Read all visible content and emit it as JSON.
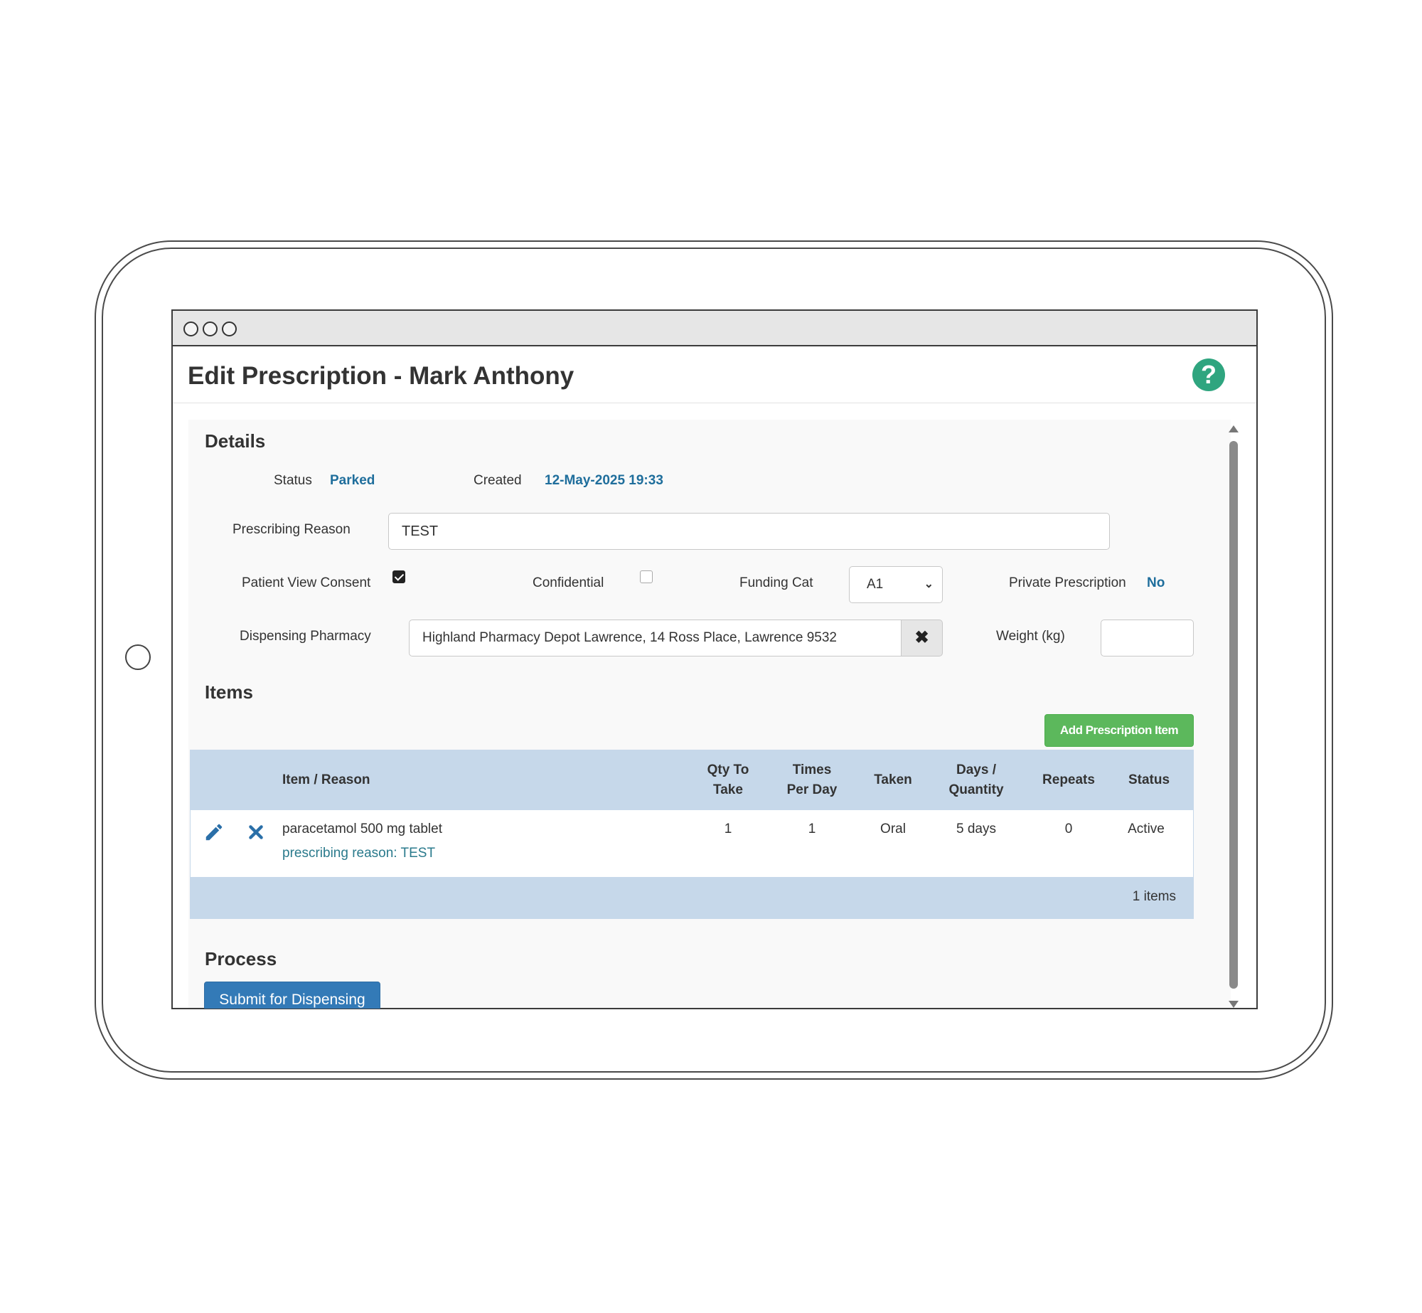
{
  "window": {
    "controls": [
      "close",
      "minimize",
      "maximize"
    ]
  },
  "header": {
    "title": "Edit Prescription - Mark Anthony",
    "help_icon": "question-circle-icon"
  },
  "details": {
    "section_title": "Details",
    "status_label": "Status",
    "status_value": "Parked",
    "created_label": "Created",
    "created_value": "12-May-2025 19:33",
    "prescribing_reason_label": "Prescribing Reason",
    "prescribing_reason_value": "TEST",
    "patient_view_consent_label": "Patient View Consent",
    "patient_view_consent_checked": true,
    "confidential_label": "Confidential",
    "confidential_checked": false,
    "funding_cat_label": "Funding Cat",
    "funding_cat_value": "A1",
    "private_prescription_label": "Private Prescription",
    "private_prescription_value": "No",
    "dispensing_pharmacy_label": "Dispensing Pharmacy",
    "dispensing_pharmacy_value": "Highland Pharmacy Depot Lawrence, 14 Ross Place, Lawrence 9532",
    "clear_glyph": "✖",
    "weight_label": "Weight (kg)",
    "weight_value": ""
  },
  "items": {
    "section_title": "Items",
    "add_button_label": "Add Prescription Item",
    "columns": {
      "item_reason": "Item / Reason",
      "qty_to_take_1": "Qty To",
      "qty_to_take_2": "Take",
      "times_per_day_1": "Times",
      "times_per_day_2": "Per Day",
      "taken": "Taken",
      "days_quantity_1": "Days /",
      "days_quantity_2": "Quantity",
      "repeats": "Repeats",
      "status": "Status"
    },
    "rows": [
      {
        "item": "paracetamol 500 mg tablet",
        "reason": "prescribing reason: TEST",
        "qty_to_take": "1",
        "times_per_day": "1",
        "taken": "Oral",
        "days_quantity": "5 days",
        "repeats": "0",
        "status": "Active"
      }
    ],
    "footer_count": "1 items"
  },
  "process": {
    "section_title": "Process",
    "submit_label": "Submit for Dispensing"
  },
  "colors": {
    "accent_link": "#1f6e9c",
    "add_button": "#5cb85c",
    "submit_button": "#337ab7",
    "table_header": "#c6d8ea",
    "help_icon": "#2fa57f"
  }
}
